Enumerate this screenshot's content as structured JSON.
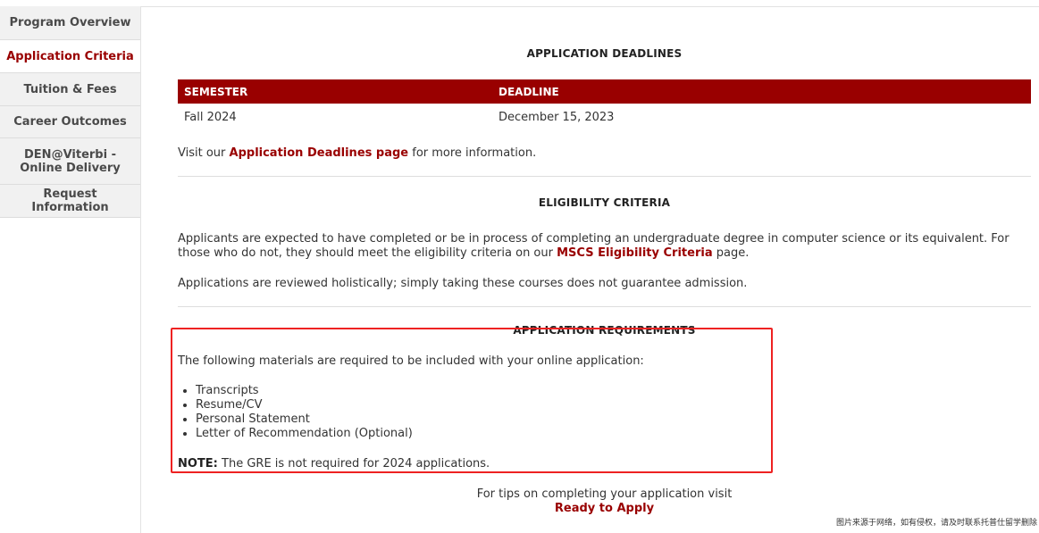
{
  "sidebar": {
    "items": [
      {
        "label": "Program Overview",
        "active": false
      },
      {
        "label": "Application Criteria",
        "active": true
      },
      {
        "label": "Tuition & Fees",
        "active": false
      },
      {
        "label": "Career Outcomes",
        "active": false
      },
      {
        "label": "DEN@Viterbi - Online Delivery",
        "active": false
      },
      {
        "label": "Request Information",
        "active": false
      }
    ]
  },
  "deadlines": {
    "title": "APPLICATION DEADLINES",
    "headers": [
      "SEMESTER",
      "DEADLINE"
    ],
    "rows": [
      {
        "semester": "Fall 2024",
        "deadline": "December 15, 2023"
      }
    ],
    "visit_prefix": "Visit our ",
    "visit_link": "Application Deadlines page",
    "visit_suffix": " for more information."
  },
  "eligibility": {
    "title": "ELIGIBILITY CRITERIA",
    "para1_prefix": "Applicants are expected to have completed or be in process of completing an undergraduate degree in computer science or its equivalent. For those who do not, they should meet the eligibility criteria on our ",
    "para1_link": "MSCS Eligibility Criteria",
    "para1_suffix": " page.",
    "para2": "Applications are reviewed holistically; simply taking these courses does not guarantee admission."
  },
  "requirements": {
    "title": "APPLICATION REQUIREMENTS",
    "intro": "The following materials are required to be included with your online application:",
    "items": [
      "Transcripts",
      "Resume/CV",
      "Personal Statement",
      "Letter of Recommendation (Optional)"
    ],
    "note_label": "NOTE:",
    "note_text": " The GRE is not required for 2024 applications."
  },
  "tips": {
    "text": "For tips on completing your application visit",
    "link": "Ready to Apply"
  },
  "watermark": "图片来源于网络，如有侵权，请及时联系托普仕留学删除",
  "colors": {
    "accent": "#990000",
    "highlight_box": "#ee2222"
  }
}
